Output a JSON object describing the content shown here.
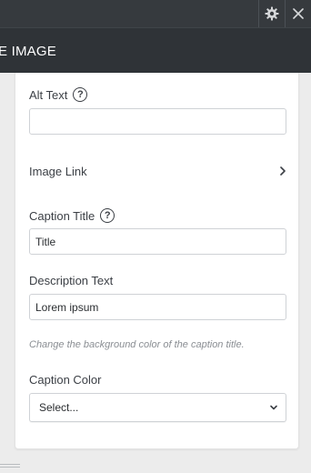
{
  "header": {
    "title": "E IMAGE",
    "settings_icon": "gear-icon",
    "close_icon": "close-icon"
  },
  "form": {
    "alt_text": {
      "label": "Alt Text",
      "value": "",
      "help_icon": "help-icon"
    },
    "image_link": {
      "label": "Image Link",
      "icon": "chevron-right-icon"
    },
    "caption_title": {
      "label": "Caption Title",
      "value": "Title",
      "help_icon": "help-icon"
    },
    "description": {
      "label": "Description Text",
      "value": "Lorem ipsum"
    },
    "hint": "Change the background color of the caption title.",
    "caption_color": {
      "label": "Caption Color",
      "selected": "Select...",
      "icon": "chevron-down-icon"
    }
  },
  "colors": {
    "topbar": "#363a3e",
    "titlebar": "#2f3337",
    "card": "#ffffff",
    "background": "#ececec"
  }
}
